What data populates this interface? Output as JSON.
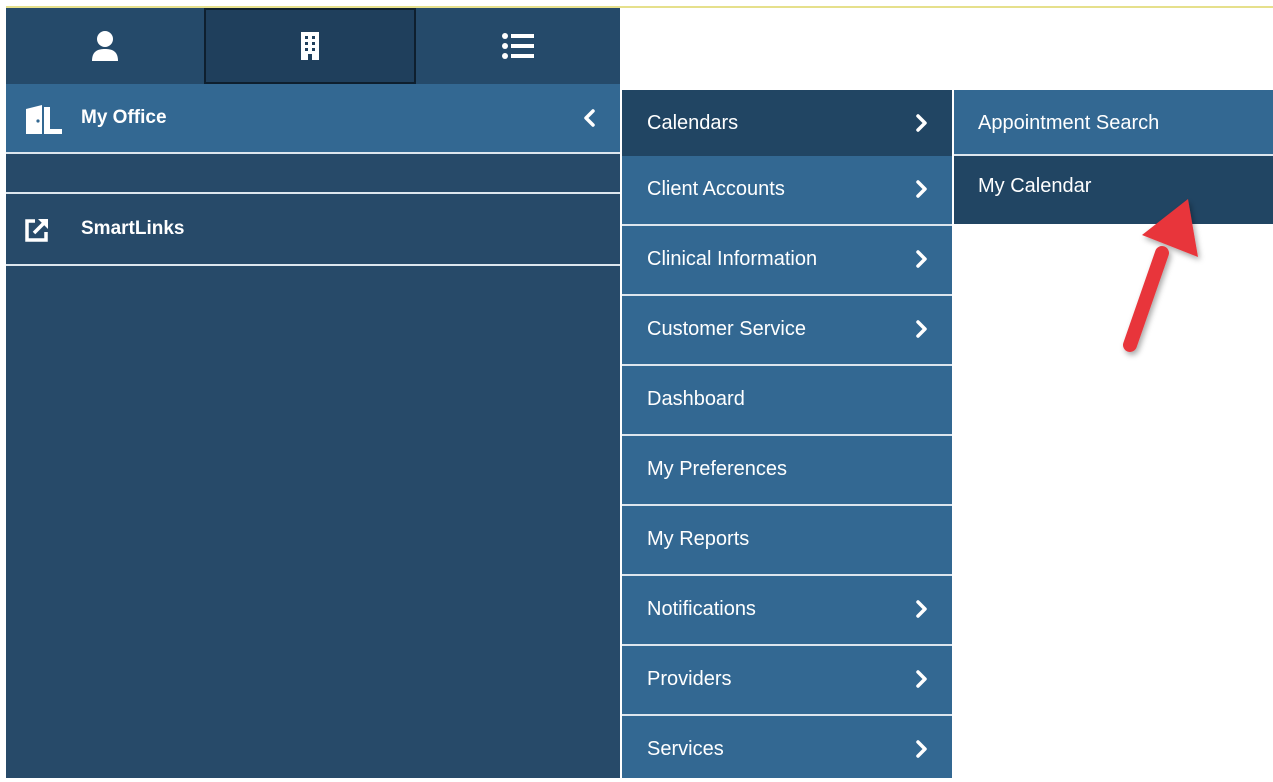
{
  "tabs": [
    {
      "icon": "user-icon"
    },
    {
      "icon": "building-icon",
      "active": true
    },
    {
      "icon": "list-icon"
    }
  ],
  "sidebar": {
    "header": {
      "label": "My Office",
      "icon": "door-icon",
      "action_icon": "chevron-left-icon"
    },
    "items": [
      {
        "label": "SmartLinks",
        "icon": "external-link-icon"
      }
    ]
  },
  "submenu": {
    "items": [
      {
        "label": "Calendars",
        "has_submenu": true,
        "active": true
      },
      {
        "label": "Client Accounts",
        "has_submenu": true
      },
      {
        "label": "Clinical Information",
        "has_submenu": true
      },
      {
        "label": "Customer Service",
        "has_submenu": true
      },
      {
        "label": "Dashboard",
        "has_submenu": false
      },
      {
        "label": "My Preferences",
        "has_submenu": false
      },
      {
        "label": "My Reports",
        "has_submenu": false
      },
      {
        "label": "Notifications",
        "has_submenu": true
      },
      {
        "label": "Providers",
        "has_submenu": true
      },
      {
        "label": "Services",
        "has_submenu": true
      }
    ]
  },
  "flyout": {
    "items": [
      {
        "label": "Appointment Search"
      },
      {
        "label": "My Calendar",
        "highlighted": true
      }
    ]
  },
  "annotation": {
    "icon": "red-arrow-icon",
    "color": "#e8353b"
  },
  "colors": {
    "nav_dark": "#274a69",
    "nav_medium": "#336892",
    "nav_active": "#214563",
    "divider": "#dde6ee",
    "top_line": "#e6e08c"
  }
}
